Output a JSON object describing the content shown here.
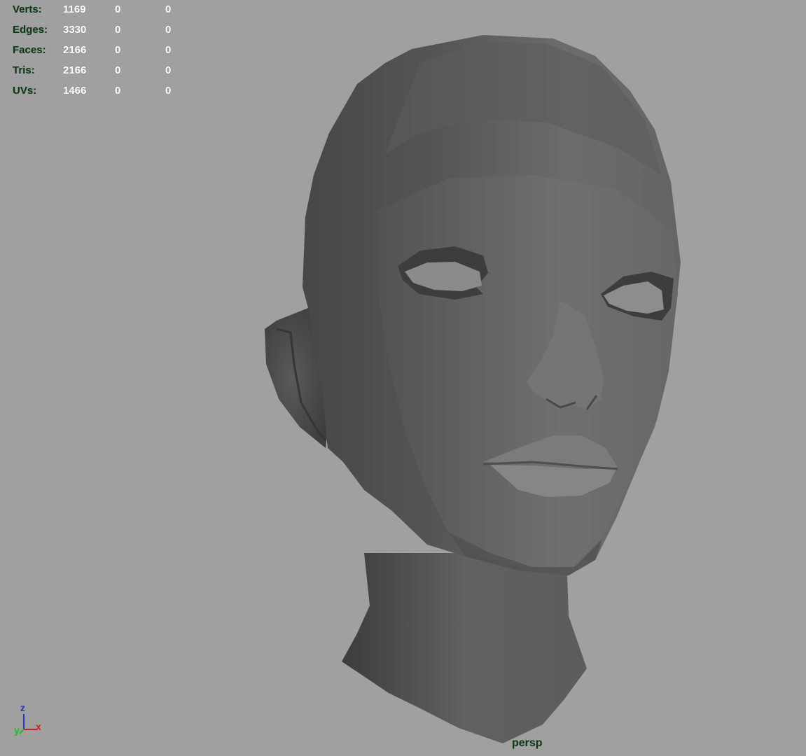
{
  "heads_up_display": {
    "rows": [
      {
        "label": "Verts:",
        "values": [
          "1169",
          "0",
          "0"
        ]
      },
      {
        "label": "Edges:",
        "values": [
          "3330",
          "0",
          "0"
        ]
      },
      {
        "label": "Faces:",
        "values": [
          "2166",
          "0",
          "0"
        ]
      },
      {
        "label": "Tris:",
        "values": [
          "2166",
          "0",
          "0"
        ]
      },
      {
        "label": "UVs:",
        "values": [
          "1466",
          "0",
          "0"
        ]
      }
    ]
  },
  "viewport": {
    "camera_name": "persp",
    "background_color": "#a0a0a0"
  },
  "axis_gizmo": {
    "z_label": "z",
    "y_label": "y",
    "x_label": "x",
    "z_color": "#2233cc",
    "y_color": "#17c21f",
    "x_color": "#d41b1b"
  },
  "colors": {
    "hud_label": "#0f3a1a",
    "hud_value": "#ffffff",
    "mesh_shade": "#6a6a6a"
  }
}
